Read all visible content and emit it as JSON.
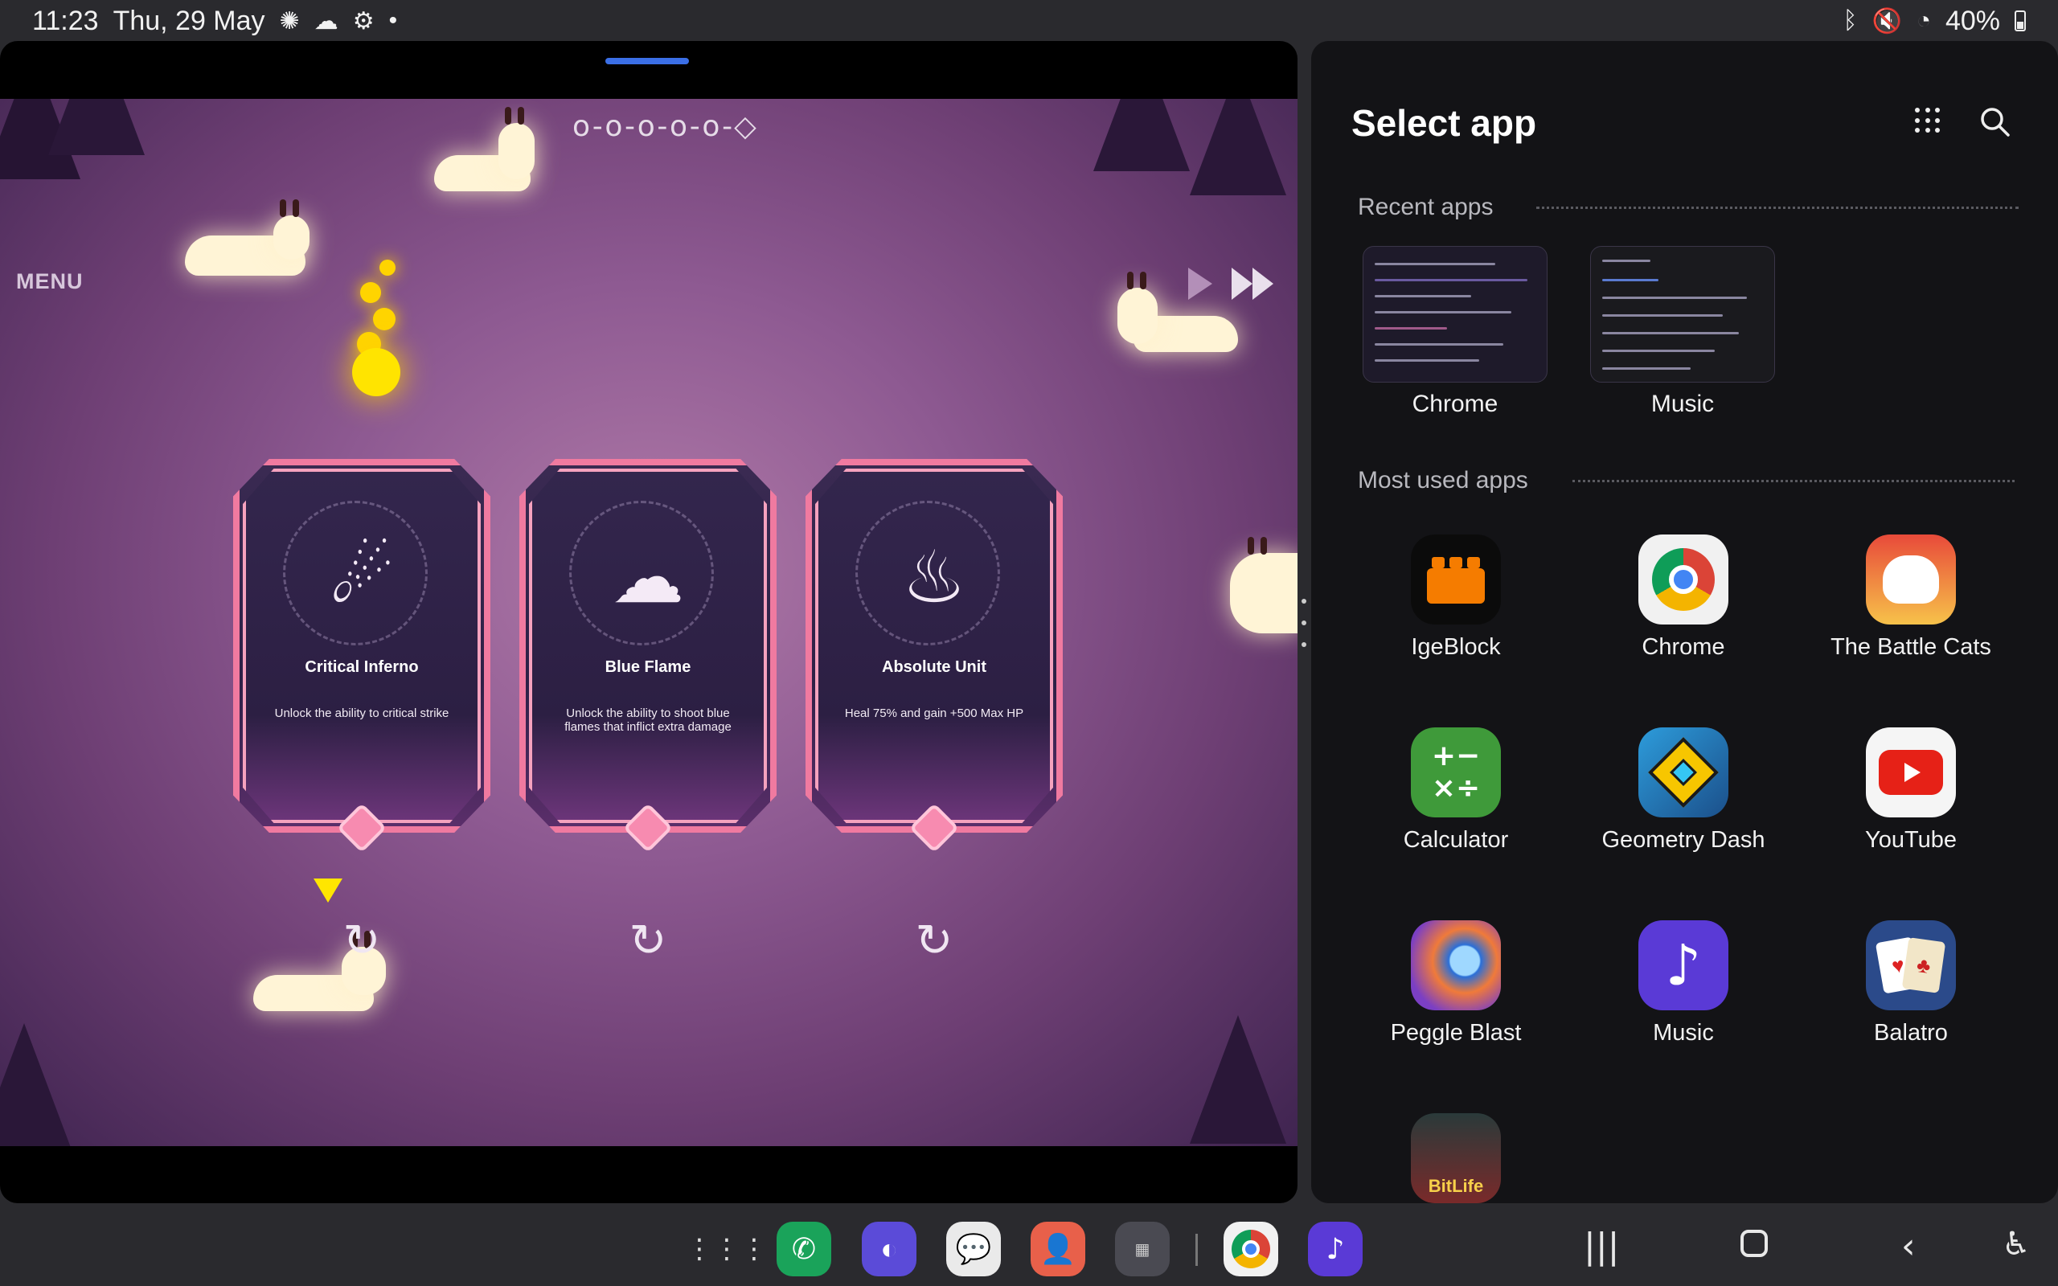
{
  "status": {
    "time": "11:23",
    "date": "Thu, 29 May",
    "battery": "40%"
  },
  "game": {
    "menu_label": "MENU",
    "progress_track": "o-o-o-o-o-◇",
    "cards": [
      {
        "title": "Critical Inferno",
        "description": "Unlock the ability to critical strike",
        "icon": "comet-icon"
      },
      {
        "title": "Blue Flame",
        "description": "Unlock the ability to shoot blue flames that inflict extra damage",
        "icon": "fireball-icon"
      },
      {
        "title": "Absolute Unit",
        "description": "Heal 75% and gain +500 Max HP",
        "icon": "flame-sparkle-icon"
      }
    ]
  },
  "app_picker": {
    "title": "Select app",
    "recent_label": "Recent apps",
    "recent_apps": [
      "Chrome",
      "Music"
    ],
    "most_used_label": "Most used apps",
    "most_used_apps": [
      "IgeBlock",
      "Chrome",
      "The Battle Cats",
      "Calculator",
      "Geometry Dash",
      "YouTube",
      "Peggle Blast",
      "Music",
      "Balatro"
    ],
    "bitlife_icon_text": "BitLife"
  },
  "colors": {
    "accent_handle": "#3b6fe6",
    "card_border": "#f07aa0",
    "pane_bg": "#131316"
  }
}
